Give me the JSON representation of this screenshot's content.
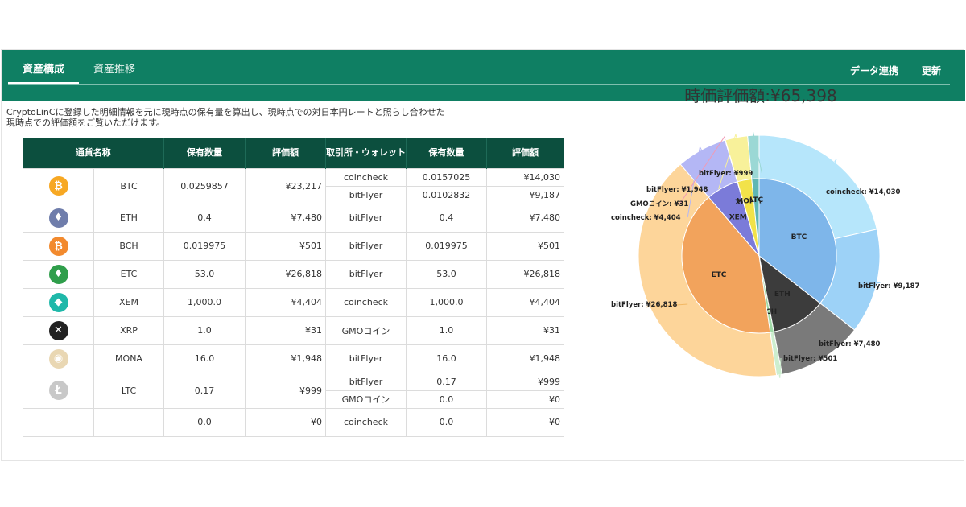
{
  "tabs": [
    {
      "label": "資産構成",
      "active": true
    },
    {
      "label": "資産推移",
      "active": false
    }
  ],
  "actions": {
    "data_link": "データ連携",
    "refresh": "更新"
  },
  "description": [
    "CryptoLinCに登録した明細情報を元に現時点の保有量を算出し、現時点での対日本円レートと照らし合わせた",
    "現時点での評価額をご覧いただけます。"
  ],
  "table": {
    "headers": [
      "通貨名称",
      "保有数量",
      "評価額",
      "取引所・ウォレット",
      "保有数量",
      "評価額"
    ],
    "coins": [
      {
        "name": "BTC",
        "icon": "bitcoin-icon",
        "color": "#f7a823",
        "glyph": "₿",
        "qty": "0.0259857",
        "value": "¥23,217",
        "exchanges": [
          {
            "name": "coincheck",
            "qty": "0.0157025",
            "value": "¥14,030"
          },
          {
            "name": "bitFlyer",
            "qty": "0.0102832",
            "value": "¥9,187"
          }
        ]
      },
      {
        "name": "ETH",
        "icon": "ethereum-icon",
        "color": "#6f7dab",
        "glyph": "♦",
        "qty": "0.4",
        "value": "¥7,480",
        "exchanges": [
          {
            "name": "bitFlyer",
            "qty": "0.4",
            "value": "¥7,480"
          }
        ]
      },
      {
        "name": "BCH",
        "icon": "bitcoin-cash-icon",
        "color": "#f28a2e",
        "glyph": "₿",
        "qty": "0.019975",
        "value": "¥501",
        "exchanges": [
          {
            "name": "bitFlyer",
            "qty": "0.019975",
            "value": "¥501"
          }
        ]
      },
      {
        "name": "ETC",
        "icon": "ethereum-classic-icon",
        "color": "#2f9e4b",
        "glyph": "♦",
        "qty": "53.0",
        "value": "¥26,818",
        "exchanges": [
          {
            "name": "bitFlyer",
            "qty": "53.0",
            "value": "¥26,818"
          }
        ]
      },
      {
        "name": "XEM",
        "icon": "nem-icon",
        "color": "#1fb8a9",
        "glyph": "◆",
        "qty": "1,000.0",
        "value": "¥4,404",
        "exchanges": [
          {
            "name": "coincheck",
            "qty": "1,000.0",
            "value": "¥4,404"
          }
        ]
      },
      {
        "name": "XRP",
        "icon": "ripple-icon",
        "color": "#222222",
        "glyph": "✕",
        "qty": "1.0",
        "value": "¥31",
        "exchanges": [
          {
            "name": "GMOコイン",
            "qty": "1.0",
            "value": "¥31"
          }
        ]
      },
      {
        "name": "MONA",
        "icon": "monacoin-icon",
        "color": "#e9d7b3",
        "glyph": "◉",
        "qty": "16.0",
        "value": "¥1,948",
        "exchanges": [
          {
            "name": "bitFlyer",
            "qty": "16.0",
            "value": "¥1,948"
          }
        ]
      },
      {
        "name": "LTC",
        "icon": "litecoin-icon",
        "color": "#c8c8c8",
        "glyph": "Ł",
        "qty": "0.17",
        "value": "¥999",
        "exchanges": [
          {
            "name": "bitFlyer",
            "qty": "0.17",
            "value": "¥999"
          },
          {
            "name": "GMOコイン",
            "qty": "0.0",
            "value": "¥0"
          }
        ]
      },
      {
        "name": "",
        "icon": "",
        "color": "",
        "glyph": "",
        "qty": "0.0",
        "value": "¥0",
        "exchanges": [
          {
            "name": "coincheck",
            "qty": "0.0",
            "value": "¥0"
          }
        ]
      }
    ]
  },
  "chart_data": {
    "type": "pie",
    "title": "時価評価額:¥65,398",
    "inner": [
      {
        "label": "BTC",
        "value": 23217,
        "color": "#7eb6ea"
      },
      {
        "label": "ETH",
        "value": 7480,
        "color": "#3c3c3c"
      },
      {
        "label": "BCH",
        "value": 501,
        "color": "#9fd9a6"
      },
      {
        "label": "ETC",
        "value": 26818,
        "color": "#f2a35c"
      },
      {
        "label": "XEM",
        "value": 4404,
        "color": "#7b7bd9"
      },
      {
        "label": "XRP",
        "value": 31,
        "color": "#e8658a"
      },
      {
        "label": "MONA",
        "value": 1948,
        "color": "#f2e24a"
      },
      {
        "label": "LTC",
        "value": 999,
        "color": "#5fb7b4"
      }
    ],
    "outer": [
      {
        "label": "coincheck: ¥14,030",
        "value": 14030,
        "color": "#b6e6fb"
      },
      {
        "label": "bitFlyer: ¥9,187",
        "value": 9187,
        "color": "#9dd2f7"
      },
      {
        "label": "bitFlyer: ¥7,480",
        "value": 7480,
        "color": "#7a7a7a"
      },
      {
        "label": "bitFlyer: ¥501",
        "value": 501,
        "color": "#cdeecf"
      },
      {
        "label": "bitFlyer: ¥26,818",
        "value": 26818,
        "color": "#fdd59a"
      },
      {
        "label": "coincheck: ¥4,404",
        "value": 4404,
        "color": "#b4b7f5"
      },
      {
        "label": "GMOコイン: ¥31",
        "value": 31,
        "color": "#f19ab4"
      },
      {
        "label": "bitFlyer: ¥1,948",
        "value": 1948,
        "color": "#f8f19a"
      },
      {
        "label": "bitFlyer: ¥999",
        "value": 999,
        "color": "#9bd8d5"
      }
    ]
  }
}
